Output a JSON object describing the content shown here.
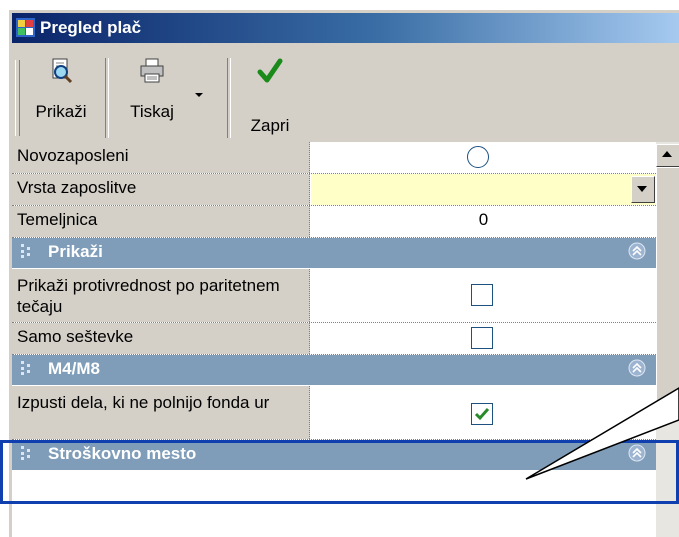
{
  "window": {
    "title": "Pregled plač"
  },
  "toolbar": {
    "show_label": "Prikaži",
    "print_label": "Tiskaj",
    "close_label": "Zapri"
  },
  "grid": {
    "rows_top": [
      {
        "label": "Novozaposleni",
        "editor": "radio",
        "checked": false
      },
      {
        "label": "Vrsta zaposlitve",
        "editor": "dropdown",
        "value": ""
      },
      {
        "label": "Temeljnica",
        "editor": "number",
        "value": "0"
      }
    ],
    "category_show": {
      "title": "Prikaži",
      "rows": [
        {
          "label": "Prikaži protivrednost po paritetnem tečaju",
          "editor": "checkbox",
          "checked": false
        },
        {
          "label": "Samo seštevke",
          "editor": "checkbox",
          "checked": false
        }
      ]
    },
    "category_m4m8": {
      "title": "M4/M8",
      "rows": [
        {
          "label": "Izpusti dela, ki ne polnijo fonda ur",
          "editor": "checkbox",
          "checked": true
        }
      ]
    },
    "category_cost": {
      "title": "Stroškovno mesto"
    }
  },
  "colors": {
    "category_bar": "#7f9db9",
    "dropdown_field": "#ffffc8",
    "highlight_box": "#1040b0",
    "check_mark": "#2a8a2a"
  }
}
